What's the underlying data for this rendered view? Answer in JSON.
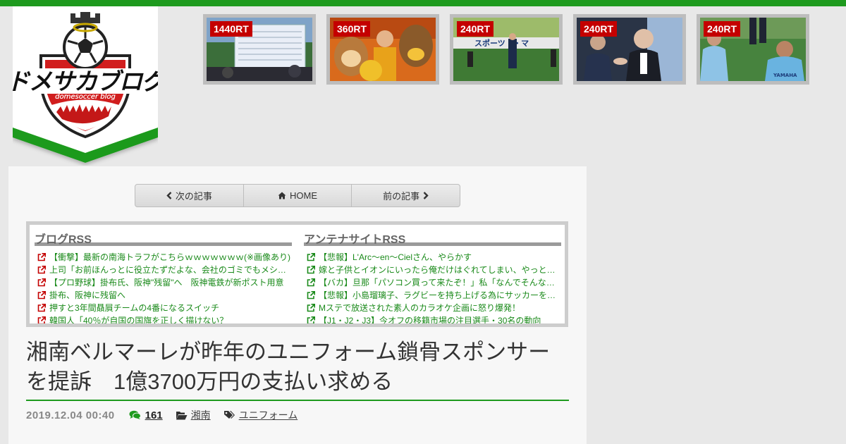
{
  "colors": {
    "accent_green": "#1e9a1e",
    "rt_badge": "#c40000",
    "link_green": "#1a8a1a",
    "ext_icon_red": "#c40000"
  },
  "logo": {
    "title": "ドメサカブログ",
    "subtitle": "domesoccer blog"
  },
  "ranking": [
    {
      "label": "1440RT"
    },
    {
      "label": "360RT"
    },
    {
      "label": "240RT"
    },
    {
      "label": "240RT"
    },
    {
      "label": "240RT"
    }
  ],
  "nav": {
    "next_label": "次の記事",
    "home_label": "HOME",
    "prev_label": "前の記事"
  },
  "rss": {
    "blog": {
      "heading": "ブログRSS",
      "items": [
        "【衝撃】最新の南海トラフがこちらｗｗｗｗｗｗｗ(※画像あり)",
        "上司「お前ほんっとに役立たずだよな、会社のゴミでもメシ食ってろ」",
        "【プロ野球】掛布氏、阪神\"残留\"へ　阪神電鉄が新ポスト用意",
        "掛布、阪神に残留へ",
        "押すと3年間贔屓チームの4番になるスイッチ",
        "韓国人「40％が自国の国旗を正しく描けない？"
      ]
    },
    "antenna": {
      "heading": "アンテナサイトRSS",
      "items": [
        "【悲報】L'Arc～en～Cielさん、やらかす",
        "嫁と子供とイオンにいったら俺だけはぐれてしまい、やっと見つけたと思ったら",
        "【バカ】旦那「パソコン買って来たぞ！」私「なんでそんなもん…",
        "【悲報】小島瑠璃子、ラグビーを持ち上げる為にサッカーを下げてしまう",
        "Mステで放送された素人のカラオケ企画に怒り爆発！",
        "【J1・J2・J3】今オフの移籍市場の注目選手・30名の動向"
      ]
    }
  },
  "article": {
    "title": "湘南ベルマーレが昨年のユニフォーム鎖骨スポンサーを提訴　1億3700万円の支払い求める",
    "date": "2019.12.04 00:40",
    "comment_count": "161",
    "category": "湘南",
    "tag": "ユニフォーム"
  },
  "icons": {
    "next": "chevron-left-icon",
    "home": "home-icon",
    "prev": "chevron-right-icon",
    "external": "external-link-icon",
    "comments": "comments-icon",
    "folder": "folder-open-icon",
    "tags": "tags-icon"
  }
}
